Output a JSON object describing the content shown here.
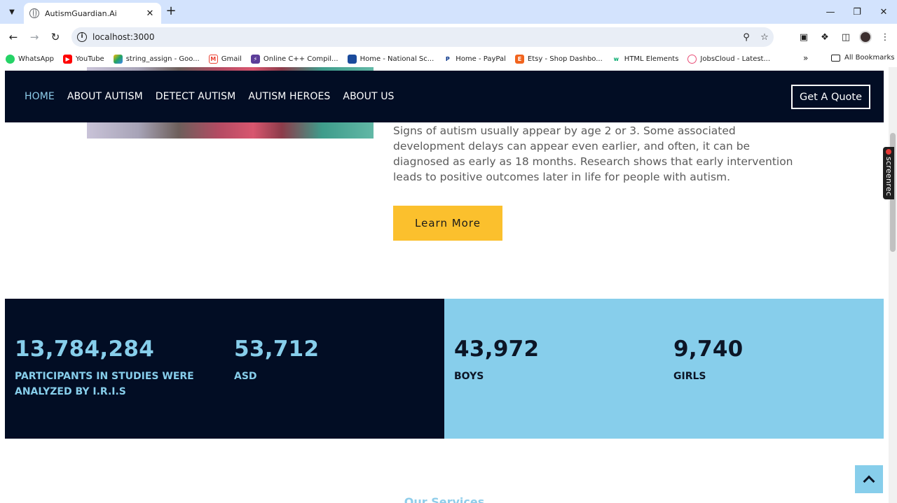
{
  "browser": {
    "tab_title": "AutismGuardian.Ai",
    "url": "localhost:3000",
    "bookmarks": [
      {
        "label": "WhatsApp",
        "icon": "whatsapp-icon",
        "color": "#25d366"
      },
      {
        "label": "YouTube",
        "icon": "youtube-icon",
        "color": "#ff0000"
      },
      {
        "label": "string_assign - Goo...",
        "icon": "drive-icon",
        "color": "#1fa463"
      },
      {
        "label": "Gmail",
        "icon": "gmail-icon",
        "color": "#ea4335"
      },
      {
        "label": "Online C++ Compil...",
        "icon": "compiler-icon",
        "color": "#5c3d99"
      },
      {
        "label": "Home - National Sc...",
        "icon": "nsp-icon",
        "color": "#1a4b9c"
      },
      {
        "label": "Home - PayPal",
        "icon": "paypal-icon",
        "color": "#003087"
      },
      {
        "label": "Etsy - Shop Dashbo...",
        "icon": "etsy-icon",
        "color": "#f1641e"
      },
      {
        "label": "HTML Elements",
        "icon": "w3-icon",
        "color": "#04aa6d"
      },
      {
        "label": "JobsCloud - Latest...",
        "icon": "jobscloud-icon",
        "color": "#e94e77"
      }
    ],
    "all_bookmarks": "All Bookmarks"
  },
  "nav": {
    "links": [
      "HOME",
      "ABOUT AUTISM",
      "DETECT AUTISM",
      "AUTISM HEROES",
      "ABOUT US"
    ],
    "active": "HOME",
    "quote_button": "Get A Quote"
  },
  "hero": {
    "paragraph": "Signs of autism usually appear by age 2 or 3. Some associated development delays can appear even earlier, and often, it can be diagnosed as early as 18 months. Research shows that early intervention leads to positive outcomes later in life for people with autism.",
    "button": "Learn More"
  },
  "stats": [
    {
      "value": "13,784,284",
      "label": "PARTICIPANTS IN STUDIES WERE ANALYZED BY I.R.I.S"
    },
    {
      "value": "53,712",
      "label": "ASD"
    },
    {
      "value": "43,972",
      "label": "BOYS"
    },
    {
      "value": "9,740",
      "label": "GIRLS"
    }
  ],
  "services_label": "Our Services",
  "screenrec": "screenrec",
  "colors": {
    "navy": "#020d24",
    "sky": "#87ceeb",
    "accent_yellow": "#fbc02d"
  }
}
